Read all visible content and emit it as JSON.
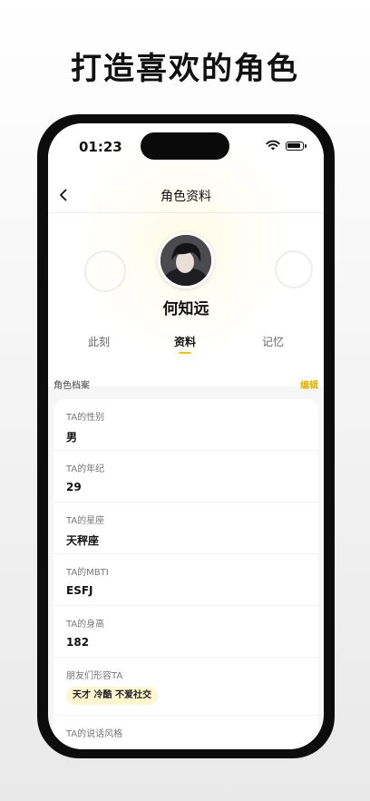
{
  "headline": "打造喜欢的角色",
  "status_bar": {
    "time": "01:23"
  },
  "nav": {
    "title": "角色资料"
  },
  "character": {
    "name": "何知远"
  },
  "tabs": [
    {
      "label": "此刻"
    },
    {
      "label": "资料",
      "active": true
    },
    {
      "label": "记忆"
    }
  ],
  "profile_section": {
    "title": "角色档案",
    "edit_label": "编辑"
  },
  "fields": [
    {
      "label": "TA的性别",
      "value": "男"
    },
    {
      "label": "TA的年纪",
      "value": "29"
    },
    {
      "label": "TA的星座",
      "value": "天秤座"
    },
    {
      "label": "TA的MBTI",
      "value": "ESFJ"
    },
    {
      "label": "TA的身高",
      "value": "182"
    },
    {
      "label": "朋友们形容TA",
      "value": "天才 冷酷 不爱社交"
    },
    {
      "label": "TA的说话风格",
      "value": ""
    }
  ],
  "colors": {
    "accent": "#f3c400",
    "tag_bg": "#fff6cf"
  },
  "icons": [
    "chevron-left-icon",
    "wifi-icon",
    "battery-icon"
  ]
}
